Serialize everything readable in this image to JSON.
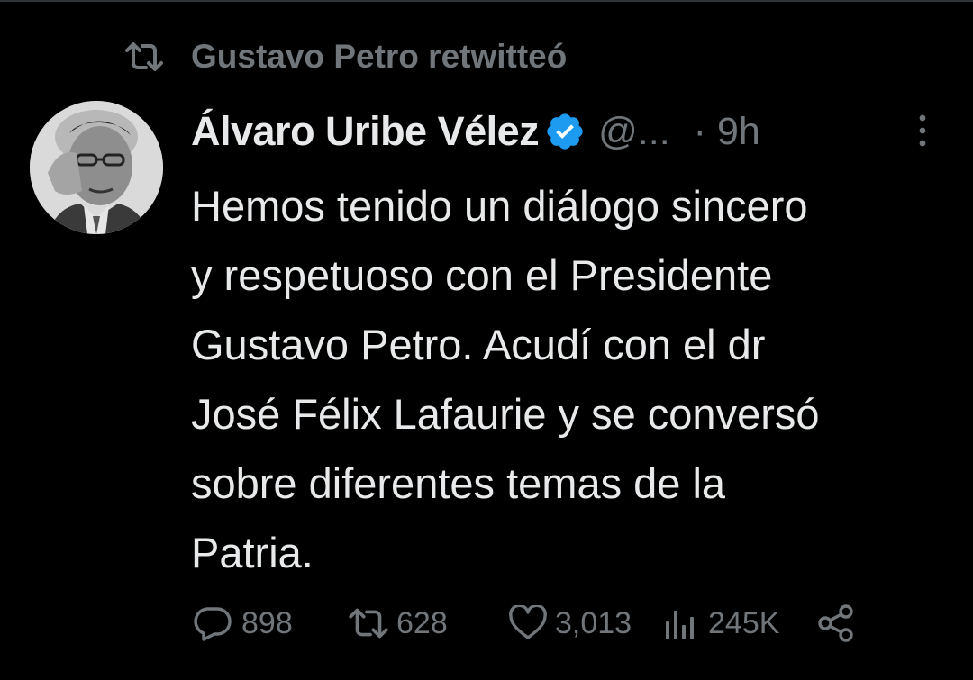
{
  "retweet_banner": {
    "icon": "retweet-icon",
    "text": "Gustavo Petro retwitteó"
  },
  "tweet": {
    "author_name": "Álvaro Uribe Vélez",
    "verified": true,
    "handle": "@...",
    "separator": "·",
    "time": "9h",
    "text_lines": [
      "Hemos tenido un diálogo sincero",
      "y respetuoso con el Presidente",
      "Gustavo Petro. Acudí con el dr",
      "José Félix Lafaurie y se conversó",
      "sobre diferentes temas de la",
      "Patria."
    ],
    "actions": {
      "replies": "898",
      "retweets": "628",
      "likes": "3,013",
      "views": "245K"
    }
  },
  "colors": {
    "background": "#000000",
    "text_primary": "#e7e9ea",
    "text_secondary": "#71767b",
    "verified_blue": "#1d9bf0"
  }
}
